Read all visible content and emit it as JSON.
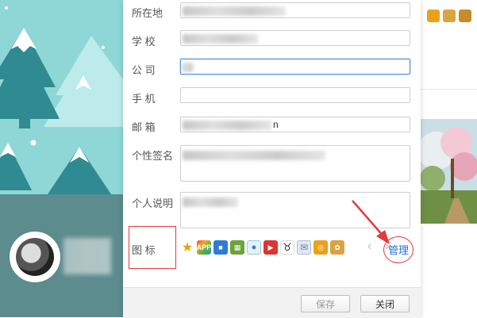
{
  "profile_form": {
    "labels": {
      "location": "所在地",
      "school": "学  校",
      "company": "公  司",
      "phone": "手  机",
      "email": "邮  箱",
      "signature": "个性签名",
      "about": "个人说明",
      "icons": "图  标"
    },
    "email_suffix": "n"
  },
  "icons_row": {
    "items": [
      "star-icon",
      "app-icon",
      "camera-icon",
      "gift-icon",
      "eye-icon",
      "video-icon",
      "cow-icon",
      "mail-icon",
      "coin-icon",
      "dog-icon"
    ],
    "manage_label": "管理"
  },
  "footer": {
    "save_label": "保存",
    "close_label": "关闭"
  },
  "colors": {
    "accent": "#1e6fd9",
    "annotation": "#e03b3b",
    "teal_bg": "#5d8c8e",
    "sky_bg": "#8fd7d7"
  }
}
